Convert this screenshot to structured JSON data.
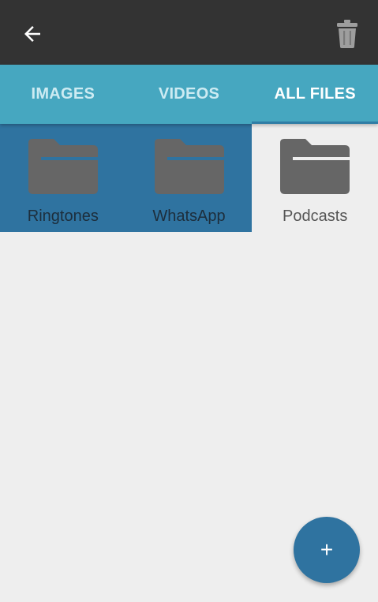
{
  "toolbar": {
    "back_icon": "arrow-left-icon",
    "delete_icon": "trash-icon"
  },
  "tabs": [
    {
      "label": "IMAGES",
      "active": false
    },
    {
      "label": "VIDEOS",
      "active": false
    },
    {
      "label": "ALL FILES",
      "active": true
    }
  ],
  "folders": [
    {
      "name": "Ringtones",
      "selected": true
    },
    {
      "name": "WhatsApp",
      "selected": true
    },
    {
      "name": "Podcasts",
      "selected": false
    }
  ],
  "fab": {
    "label": "+",
    "icon": "plus-icon"
  },
  "colors": {
    "toolbar": "#333333",
    "tabbar": "#46a7c0",
    "selection": "#2f73a0",
    "folder_icon": "#666666",
    "background": "#eeeeee"
  }
}
